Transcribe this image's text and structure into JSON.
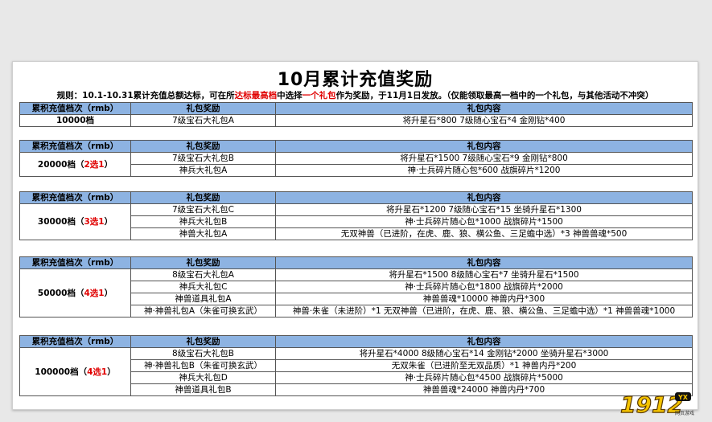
{
  "title": "10月累计充值奖励",
  "rules": {
    "p1": "规则：10.1-10.31累计充值总额达标，可在所",
    "p2": "达标最高档",
    "p3": "中选择",
    "p4": "一个礼包",
    "p5": "作为奖励，于11月1日发放。（仅能领取最高一档中的一个礼包，与其他活动不冲突）"
  },
  "headers": {
    "level": "累积充值档次（rmb）",
    "pack": "礼包奖励",
    "content": "礼包内容"
  },
  "tiers": [
    {
      "level": "10000档",
      "choice": "",
      "packs": [
        {
          "name": "7级宝石大礼包A",
          "content": "将升星石*800  7级随心宝石*4  金刚钻*400"
        }
      ]
    },
    {
      "level": "20000档（",
      "choice": "2选1",
      "close": "）",
      "packs": [
        {
          "name": "7级宝石大礼包B",
          "content": "将升星石*1500  7级随心宝石*9  金刚钻*800"
        },
        {
          "name": "神兵大礼包A",
          "content": "神·士兵碎片随心包*600  战旗碎片*1200"
        }
      ]
    },
    {
      "level": "30000档（",
      "choice": "3选1",
      "close": "）",
      "packs": [
        {
          "name": "7级宝石大礼包C",
          "content": "将升星石*1200  7级随心宝石*15  坐骑升星石*1300"
        },
        {
          "name": "神兵大礼包B",
          "content": "神·士兵碎片随心包*1000  战旗碎片*1500"
        },
        {
          "name": "神兽大礼包A",
          "content": "无双神兽（已进阶，在虎、鹿、狼、横公鱼、三足蟾中选）*3    神兽兽魂*500"
        }
      ]
    },
    {
      "level": "50000档（",
      "choice": "4选1",
      "close": "）",
      "packs": [
        {
          "name": "8级宝石大礼包A",
          "content": "将升星石*1500  8级随心宝石*7   坐骑升星石*1500"
        },
        {
          "name": "神兵大礼包C",
          "content": "神·士兵碎片随心包*1800  战旗碎片*2000"
        },
        {
          "name": "神兽道具礼包A",
          "content": "神兽兽魂*10000   神兽内丹*300"
        },
        {
          "name": "神·神兽礼包A（朱雀可换玄武）",
          "content": "神兽·朱雀（未进阶）*1  无双神兽（已进阶，在虎、鹿、狼、横公鱼、三足蟾中选）*1  神兽兽魂*1000"
        }
      ]
    },
    {
      "level": "100000档（",
      "choice": "4选1",
      "close": "）",
      "packs": [
        {
          "name": "8级宝石大礼包B",
          "content": "将升星石*4000  8级随心宝石*14  金刚钻*2000 坐骑升星石*3000"
        },
        {
          "name": "神·神兽礼包B（朱雀可换玄武）",
          "content": "无双朱雀（已进阶至无双品质）*1  神兽内丹*200"
        },
        {
          "name": "神兵大礼包D",
          "content": "神·士兵碎片随心包*4500  战旗碎片*5000"
        },
        {
          "name": "神兽道具礼包B",
          "content": "神兽兽魂*24000  神兽内丹*700"
        }
      ]
    }
  ],
  "logo": {
    "text": "1912",
    "badge": "YX",
    "sub": "网页游戏"
  },
  "colors": {
    "header_bg": "#8db3e2",
    "accent_red": "#e00000",
    "logo_yellow": "#f5c400"
  }
}
